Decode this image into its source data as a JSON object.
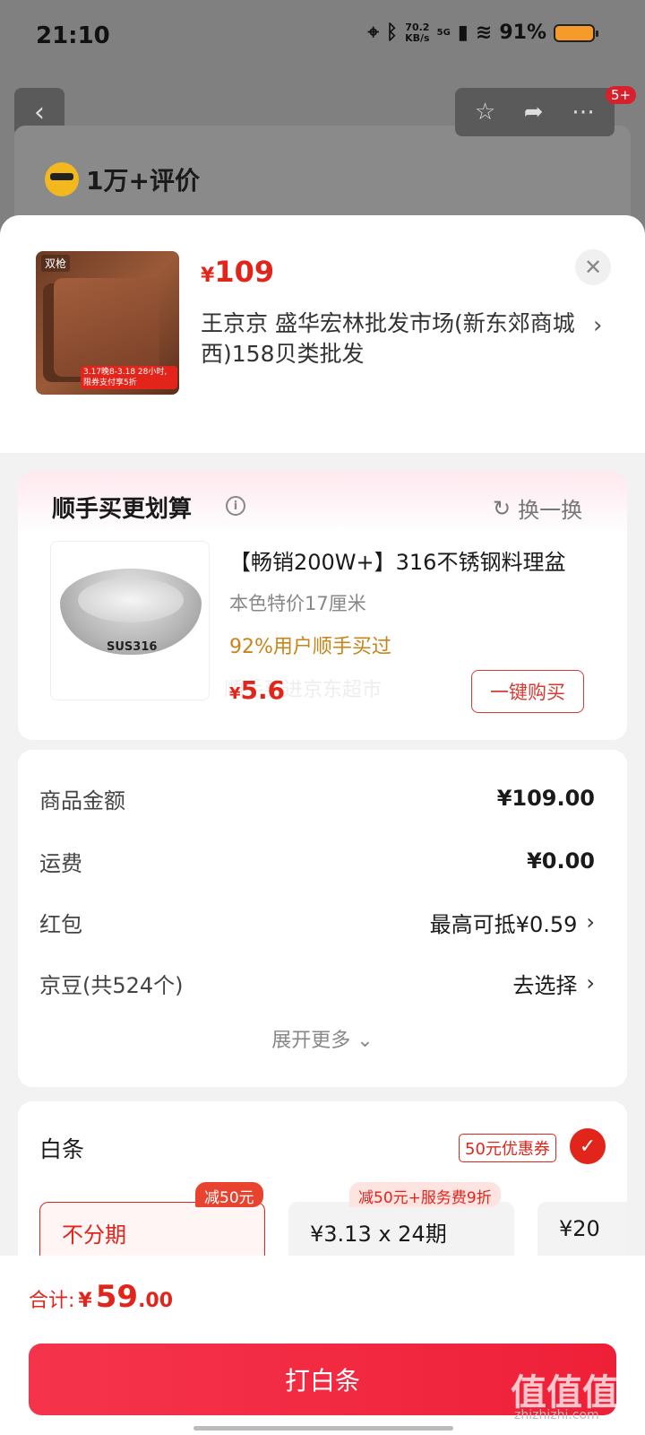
{
  "status_bar": {
    "time": "21:10",
    "net_speed": "70.2",
    "net_unit": "KB/s",
    "network": "5G",
    "battery": "91%"
  },
  "background_page": {
    "badge": "5+",
    "reviews": "1万+评价"
  },
  "product": {
    "price_symbol": "¥",
    "price": "109",
    "store_address": "王京京  盛华宏林批发市场(新东郊商城西)158贝类批发",
    "thumb_brand": "双枪",
    "thumb_promo": "3.17晚8-3.18 28小时, 限券支付享5折"
  },
  "addon": {
    "title": "顺手买更划算",
    "swap_label": "换一换",
    "name": "【畅销200W+】316不锈钢料理盆",
    "spec": "本色特价17厘米",
    "rate": "92%用户顺手买过",
    "price_symbol": "¥",
    "price": "5.6",
    "ghost_text": "顺手买进京东超市",
    "buy_label": "一键购买",
    "image_label": "SUS316"
  },
  "summary": {
    "rows": [
      {
        "label": "商品金额",
        "value": "¥109.00"
      },
      {
        "label": "运费",
        "value": "¥0.00"
      },
      {
        "label": "红包",
        "value": "最高可抵¥0.59"
      },
      {
        "label": "京豆(共524个)",
        "value": "去选择"
      }
    ],
    "expand_label": "展开更多"
  },
  "baitiao": {
    "title": "白条",
    "coupon": "50元优惠券",
    "plans": [
      {
        "tag": "减50元",
        "text": "不分期"
      },
      {
        "tag": "减50元+服务费9折",
        "text": "¥3.13 x 24期"
      },
      {
        "tag": "",
        "text": "¥20"
      }
    ]
  },
  "footer": {
    "total_label": "合计:",
    "total_yen": "¥",
    "total_int": "59",
    "total_dec": ".00",
    "pay_label": "打白条"
  },
  "watermark": {
    "text": "值值值",
    "sub": "zhizhizhi.com"
  },
  "colors": {
    "accent": "#e1251b",
    "pay_button": "#ee2038"
  }
}
